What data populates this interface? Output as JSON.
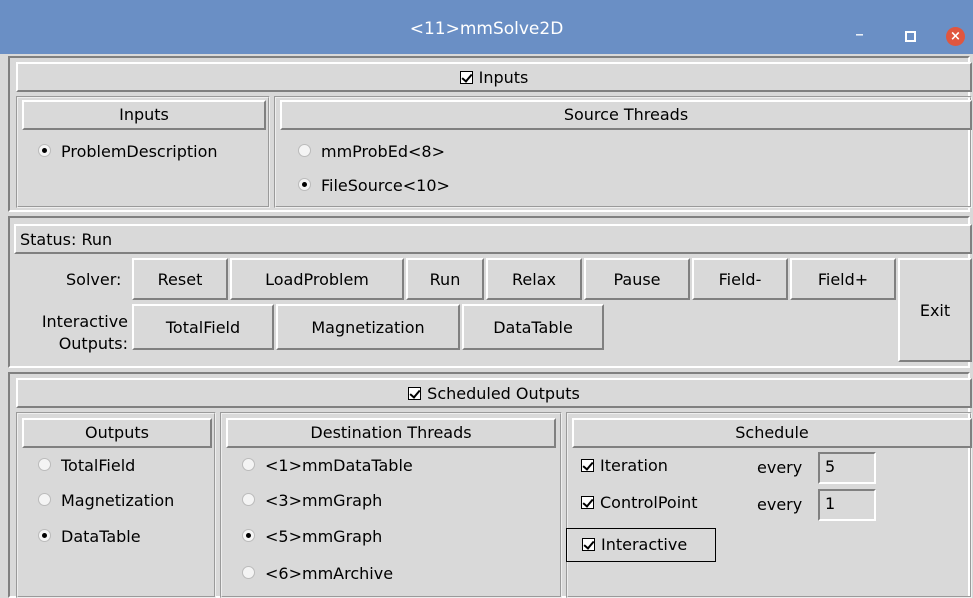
{
  "window": {
    "title": "<11>mmSolve2D"
  },
  "inputs_section": {
    "toggle_label": "Inputs",
    "inputs_header": "Inputs",
    "inputs": [
      {
        "label": "ProblemDescription",
        "selected": true
      }
    ],
    "source_header": "Source Threads",
    "sources": [
      {
        "label": "mmProbEd<8>",
        "selected": false
      },
      {
        "label": "FileSource<10>",
        "selected": true
      }
    ]
  },
  "control": {
    "status_text": "Status: Run",
    "solver_label": "Solver:",
    "solver_buttons": [
      "Reset",
      "LoadProblem",
      "Run",
      "Relax",
      "Pause",
      "Field-",
      "Field+"
    ],
    "outputs_label_line1": "Interactive",
    "outputs_label_line2": "Outputs:",
    "output_buttons": [
      "TotalField",
      "Magnetization",
      "DataTable"
    ],
    "exit_label": "Exit"
  },
  "scheduled": {
    "toggle_label": "Scheduled Outputs",
    "outputs_header": "Outputs",
    "outputs": [
      {
        "label": "TotalField",
        "selected": false
      },
      {
        "label": "Magnetization",
        "selected": false
      },
      {
        "label": "DataTable",
        "selected": true
      }
    ],
    "destinations_header": "Destination Threads",
    "destinations": [
      {
        "label": "<1>mmDataTable",
        "selected": false
      },
      {
        "label": "<3>mmGraph",
        "selected": false
      },
      {
        "label": "<5>mmGraph",
        "selected": true
      },
      {
        "label": "<6>mmArchive",
        "selected": false
      }
    ],
    "schedule_header": "Schedule",
    "schedule": [
      {
        "label": "Iteration",
        "checked": true,
        "every_label": "every",
        "value": "5"
      },
      {
        "label": "ControlPoint",
        "checked": true,
        "every_label": "every",
        "value": "1"
      },
      {
        "label": "Interactive",
        "checked": true
      }
    ]
  }
}
